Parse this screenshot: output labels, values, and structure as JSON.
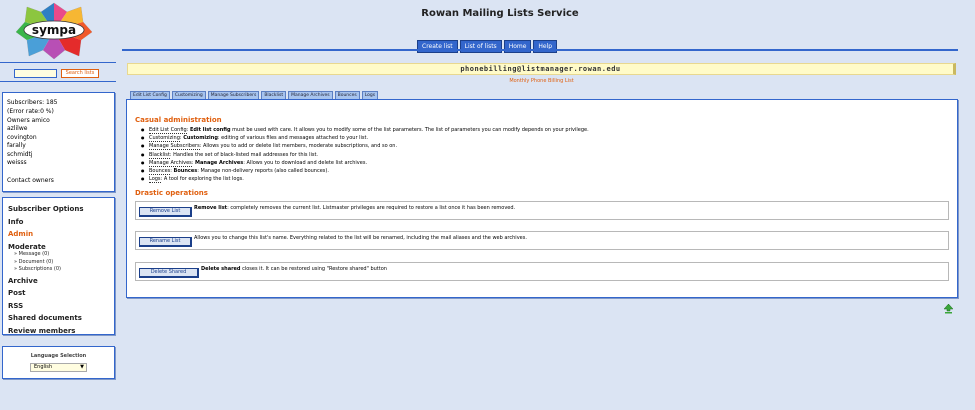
{
  "header": {
    "logo_text": "sympa",
    "title": "Rowan Mailing Lists Service",
    "nav": [
      "Create list",
      "List of lists",
      "Home",
      "Help"
    ]
  },
  "search": {
    "input_value": "",
    "button_label": "Search lists"
  },
  "list_info": {
    "subscribers": "Subscribers: 185",
    "error_rate": "(Error rate:0 %)",
    "owners_label": "Owners amico",
    "owners": [
      "azlilwe",
      "covington",
      "farally",
      "schmidtj",
      "weisss"
    ],
    "contact_owners": "Contact owners"
  },
  "menu": {
    "subscriber_options": "Subscriber Options",
    "info": "Info",
    "admin": "Admin",
    "moderate": "Moderate",
    "moderate_items": [
      "Message (0)",
      "Document (0)",
      "Subscriptions (0)"
    ],
    "archive": "Archive",
    "post": "Post",
    "rss": "RSS",
    "shared_documents": "Shared documents",
    "review_members": "Review members"
  },
  "language": {
    "title": "Language Selection",
    "selected": "English"
  },
  "main": {
    "list_address": "phonebilling@listmanager.rowan.edu",
    "list_subject": "Monthly Phone Billing List",
    "tabs": [
      "Edit List Config",
      "Customizing",
      "Manage Subscribers",
      "Blacklist",
      "Manage Archives",
      "Bounces",
      "Logs"
    ],
    "casual_title": "Casual administration",
    "casual": [
      {
        "term": "Edit List Config",
        "bold": "Edit list config",
        "text": " must be used with care. It allows you to modify some of the list parameters. The list of parameters you can modify depends on your privilege."
      },
      {
        "term": "Customizing",
        "bold": "Customizing",
        "text": ": editing of various files and messages attached to your list."
      },
      {
        "term": "Manage Subscribers",
        "bold": "",
        "text": " Allows you to add or delete list members, moderate subscriptions, and so on."
      },
      {
        "term": "Blacklist",
        "bold": "",
        "text": " Handles the set of black-listed mail addresses for this list."
      },
      {
        "term": "Manage Archives",
        "bold": "Manage Archives",
        "text": ": Allows you to download and delete list archives."
      },
      {
        "term": "Bounces",
        "bold": "Bounces",
        "text": ": Manage non-delivery reports (also called bounces)."
      },
      {
        "term": "Logs",
        "bold": "",
        "text": " A tool for exploring the list logs."
      }
    ],
    "drastic_title": "Drastic operations",
    "remove_button": "Remove List",
    "remove_bold": "Remove list",
    "remove_desc": ": completely removes the current list. Listmaster privileges are required to restore a list once it has been removed.",
    "rename_button": "Rename List",
    "rename_desc": "Allows you to change this list's name. Everything related to the list will be renamed, including the mail aliases and the web archives.",
    "delete_shared_button": "Delete Shared",
    "delete_shared_bold": "Delete shared",
    "delete_shared_desc": " closes it. It can be restored using \"Restore shared\" button"
  }
}
